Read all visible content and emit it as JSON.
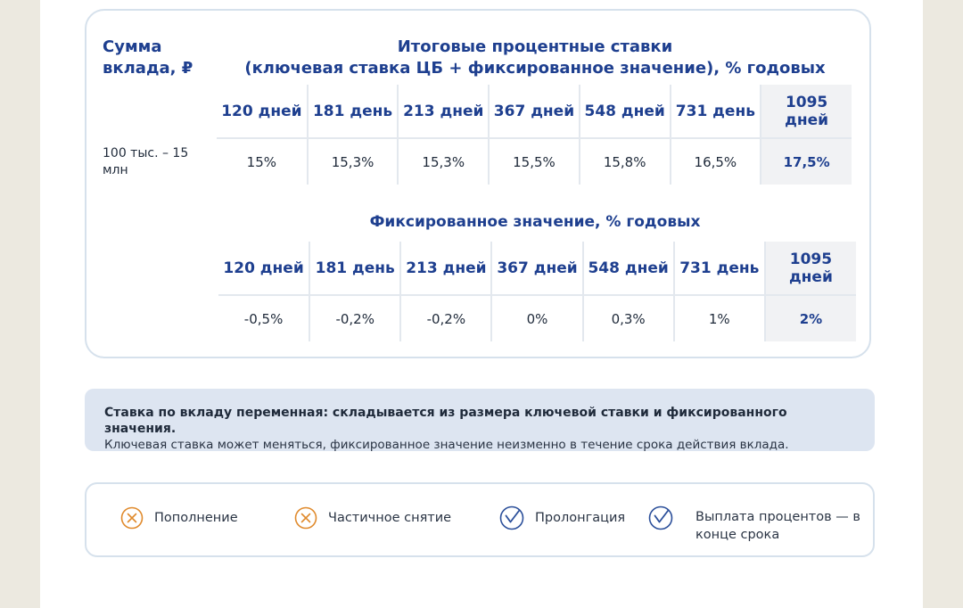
{
  "deposit_sum": {
    "title": "Сумма вклада, ₽",
    "value": "100 тыс. – 15 млн"
  },
  "final_rates": {
    "title_line1": "Итоговые процентные ставки",
    "title_line2": "(ключевая ставка ЦБ + фиксированное значение), % годовых",
    "terms": [
      "120 дней",
      "181 день",
      "213 дней",
      "367 дней",
      "548 дней",
      "731 день",
      "1095 дней"
    ],
    "values": [
      "15%",
      "15,3%",
      "15,3%",
      "15,5%",
      "15,8%",
      "16,5%",
      "17,5%"
    ]
  },
  "fixed_rates": {
    "title": "Фиксированное значение, % годовых",
    "terms": [
      "120 дней",
      "181 день",
      "213 дней",
      "367 дней",
      "548 дней",
      "731 день",
      "1095 дней"
    ],
    "values": [
      "-0,5%",
      "-0,2%",
      "-0,2%",
      "0%",
      "0,3%",
      "1%",
      "2%"
    ]
  },
  "notice": {
    "bold": "Ставка по вкладу переменная: складывается из размера ключевой ставки и фиксированного значения.",
    "text": "Ключевая ставка может меняться, фиксированное значение неизменно в течение срока действия вклада."
  },
  "features": [
    {
      "label": "Пополнение",
      "available": false,
      "icon": "cross-circle-icon"
    },
    {
      "label": "Частичное снятие",
      "available": false,
      "icon": "cross-circle-icon"
    },
    {
      "label": "Пролонгация",
      "available": true,
      "icon": "check-circle-icon"
    },
    {
      "label": "Выплата процентов — в конце срока",
      "available": true,
      "icon": "check-circle-icon"
    }
  ],
  "colors": {
    "accent": "#1e3f8f",
    "cross": "#e08a2c",
    "check": "#2b4f9a",
    "notice_bg": "#dde5f1"
  }
}
